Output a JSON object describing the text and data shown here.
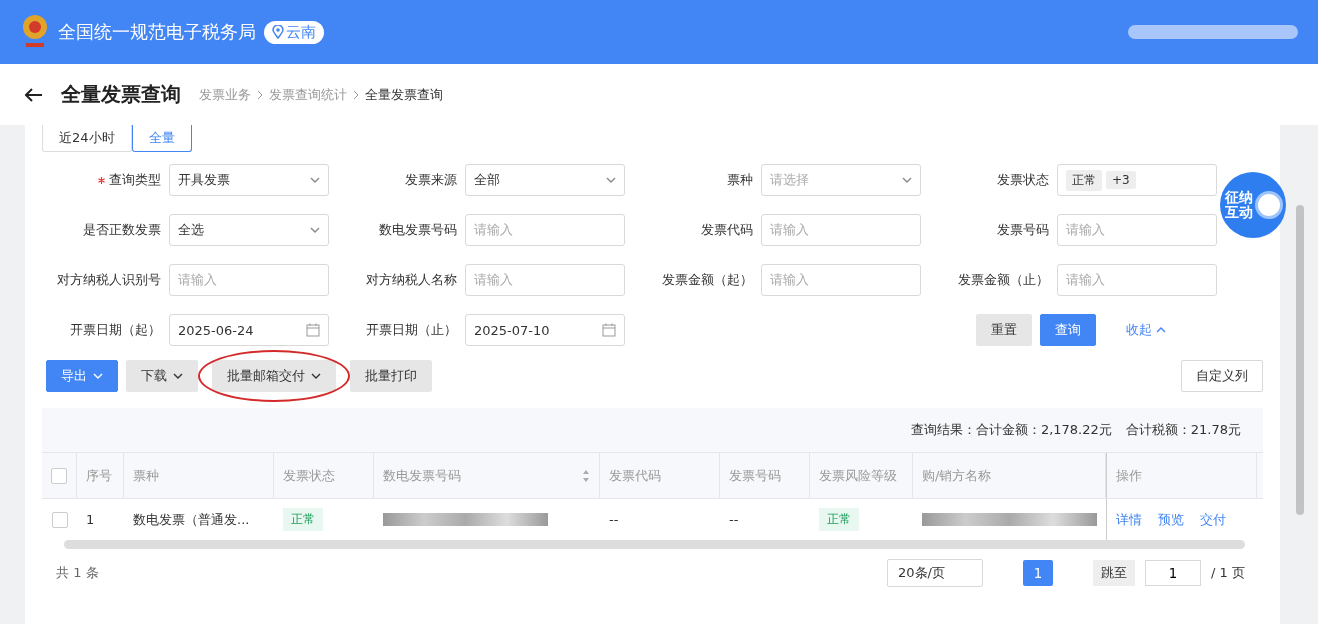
{
  "header": {
    "site_title": "全国统一规范电子税务局",
    "region": "云南"
  },
  "page": {
    "title": "全量发票查询",
    "breadcrumb": [
      "发票业务",
      "发票查询统计",
      "全量发票查询"
    ]
  },
  "range_tabs": [
    {
      "label": "近24小时",
      "selected": false
    },
    {
      "label": "全量",
      "selected": true
    }
  ],
  "filters": [
    {
      "kind": "select",
      "label": "查询类型",
      "required": true,
      "value": "开具发票"
    },
    {
      "kind": "select",
      "label": "发票来源",
      "required": false,
      "value": "全部"
    },
    {
      "kind": "select",
      "label": "票种",
      "required": false,
      "placeholder": "请选择"
    },
    {
      "kind": "tags",
      "label": "发票状态",
      "required": false,
      "tags": [
        "正常",
        "+3"
      ]
    },
    {
      "kind": "select",
      "label": "是否正数发票",
      "required": false,
      "value": "全选"
    },
    {
      "kind": "input",
      "label": "数电发票号码",
      "required": false,
      "placeholder": "请输入"
    },
    {
      "kind": "input",
      "label": "发票代码",
      "required": false,
      "placeholder": "请输入"
    },
    {
      "kind": "input",
      "label": "发票号码",
      "required": false,
      "placeholder": "请输入"
    },
    {
      "kind": "input",
      "label": "对方纳税人识别号",
      "required": false,
      "placeholder": "请输入"
    },
    {
      "kind": "input",
      "label": "对方纳税人名称",
      "required": false,
      "placeholder": "请输入"
    },
    {
      "kind": "input",
      "label": "发票金额（起）",
      "required": false,
      "placeholder": "请输入"
    },
    {
      "kind": "input",
      "label": "发票金额（止）",
      "required": false,
      "placeholder": "请输入"
    },
    {
      "kind": "date",
      "label": "开票日期（起）",
      "required": false,
      "value": "2025-06-24"
    },
    {
      "kind": "date",
      "label": "开票日期（止）",
      "required": false,
      "value": "2025-07-10"
    }
  ],
  "form_actions": {
    "reset": "重置",
    "search": "查询",
    "collapse": "收起"
  },
  "toolbar": [
    {
      "kind": "primary",
      "label": "导出",
      "dropdown": true,
      "circled": false
    },
    {
      "kind": "default",
      "label": "下载",
      "dropdown": true,
      "circled": false
    },
    {
      "kind": "default",
      "label": "批量邮箱交付",
      "dropdown": true,
      "circled": true
    },
    {
      "kind": "default",
      "label": "批量打印",
      "dropdown": false,
      "circled": false
    }
  ],
  "customize_columns": "自定义列",
  "summary": [
    "查询结果：合计金额：2,178.22元",
    "合计税额：21.78元"
  ],
  "table": {
    "select_all_checked": false,
    "columns": [
      {
        "label": "序号",
        "sortable": false
      },
      {
        "label": "票种",
        "sortable": false
      },
      {
        "label": "发票状态",
        "sortable": false
      },
      {
        "label": "数电发票号码",
        "sortable": true
      },
      {
        "label": "发票代码",
        "sortable": false
      },
      {
        "label": "发票号码",
        "sortable": false
      },
      {
        "label": "发票风险等级",
        "sortable": false
      },
      {
        "label": "购/销方名称",
        "sortable": false
      },
      {
        "label": "操作",
        "sortable": false
      }
    ],
    "rows": [
      {
        "checked": false,
        "index": "1",
        "type": "数电发票（普通发...",
        "status": "正常",
        "code": "--",
        "number": "--",
        "risk": "正常",
        "actions": [
          "详情",
          "预览",
          "交付"
        ]
      }
    ]
  },
  "pagination": {
    "total": "共 1 条",
    "page_size": "20条/页",
    "pages": [
      {
        "label": "1",
        "selected": true
      }
    ],
    "jump_label": "跳至",
    "jump_value": "1",
    "page_count": "/ 1 页"
  },
  "assistant": {
    "label": "征纳互动"
  }
}
